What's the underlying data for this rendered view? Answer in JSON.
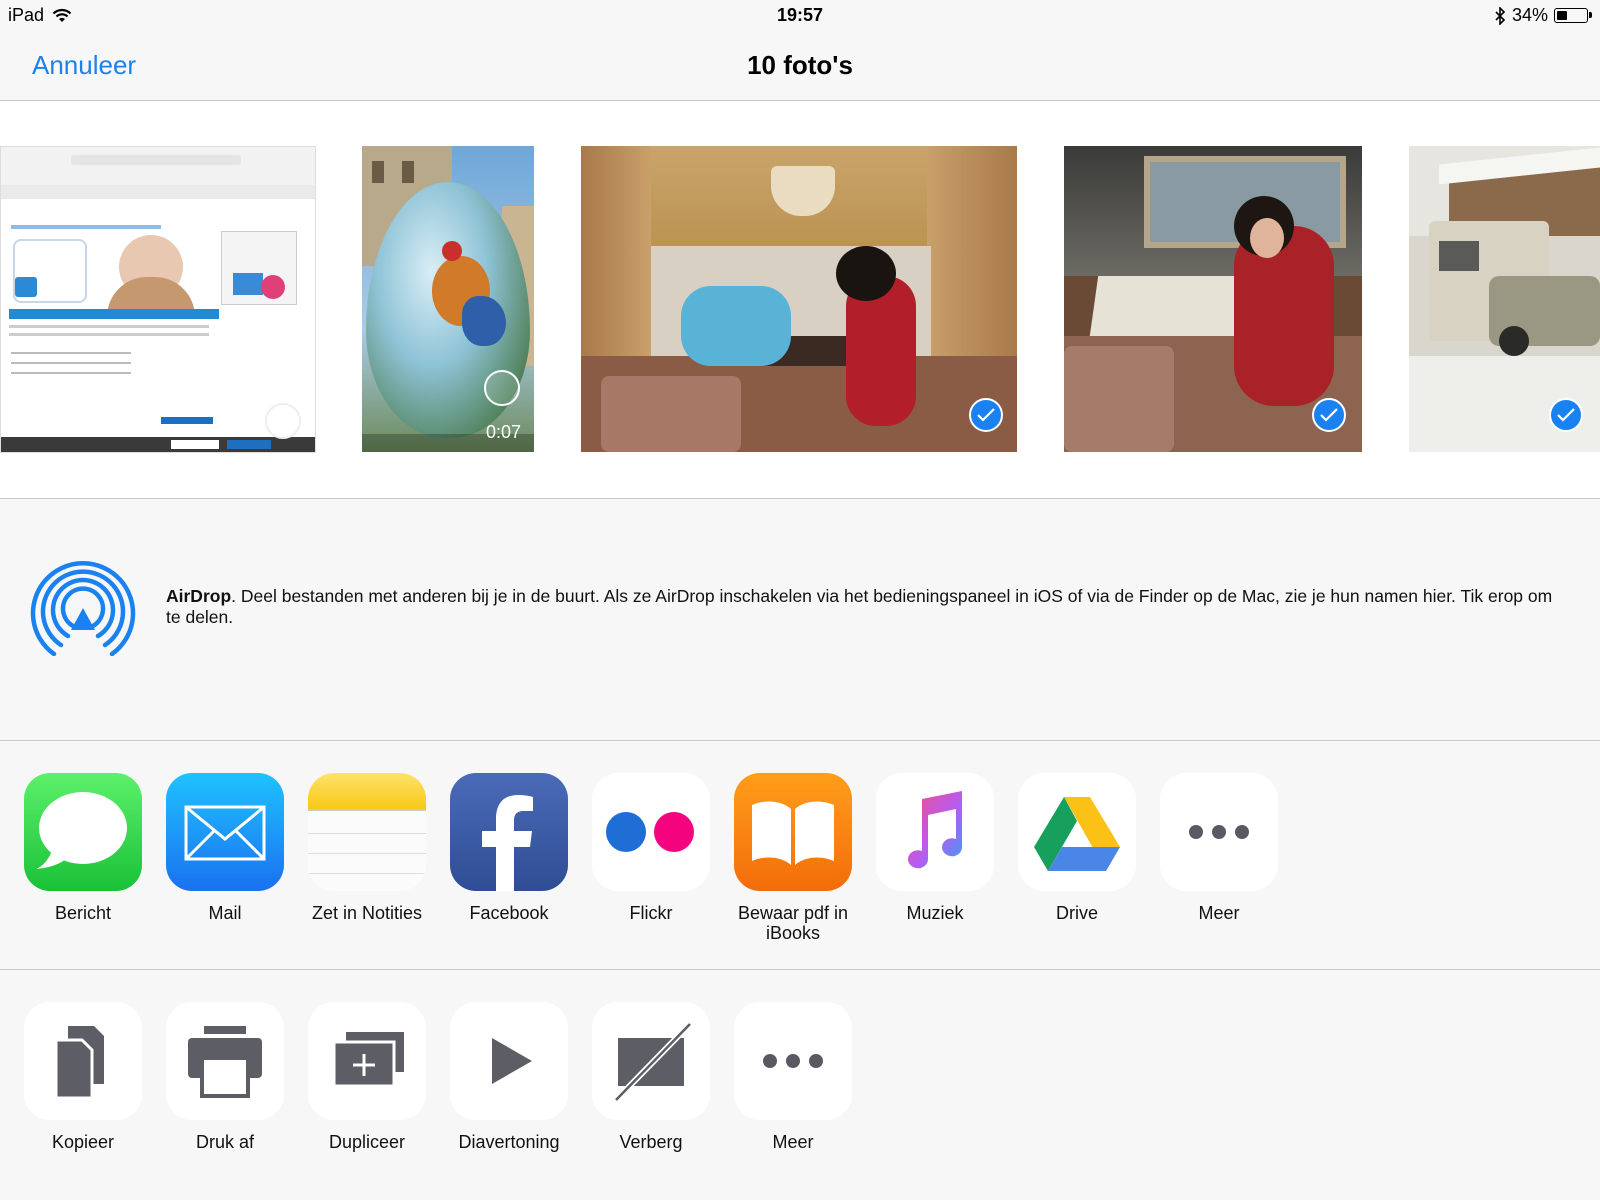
{
  "status_bar": {
    "device": "iPad",
    "time": "19:57",
    "battery_percent": "34%"
  },
  "nav": {
    "cancel_label": "Annuleer",
    "title": "10 foto's"
  },
  "photos": [
    {
      "kind": "screenshot",
      "selected": false
    },
    {
      "kind": "video",
      "duration": "0:07",
      "selected": false
    },
    {
      "kind": "photo",
      "selected": true
    },
    {
      "kind": "photo",
      "selected": true
    },
    {
      "kind": "photo",
      "selected": true
    }
  ],
  "airdrop": {
    "title": "AirDrop",
    "description": ". Deel bestanden met anderen bij je in de buurt. Als ze AirDrop inschakelen via het bedieningspaneel in iOS of via de Finder op de Mac, zie je hun namen hier. Tik erop om te delen."
  },
  "share_apps": [
    {
      "label": "Bericht",
      "icon": "messages-icon"
    },
    {
      "label": "Mail",
      "icon": "mail-icon"
    },
    {
      "label": "Zet in Notities",
      "icon": "notes-icon"
    },
    {
      "label": "Facebook",
      "icon": "facebook-icon"
    },
    {
      "label": "Flickr",
      "icon": "flickr-icon"
    },
    {
      "label": "Bewaar pdf in iBooks",
      "icon": "ibooks-icon"
    },
    {
      "label": "Muziek",
      "icon": "music-icon"
    },
    {
      "label": "Drive",
      "icon": "drive-icon"
    },
    {
      "label": "Meer",
      "icon": "more-icon"
    }
  ],
  "actions": [
    {
      "label": "Kopieer",
      "icon": "copy-icon"
    },
    {
      "label": "Druk af",
      "icon": "print-icon"
    },
    {
      "label": "Dupliceer",
      "icon": "duplicate-icon"
    },
    {
      "label": "Diavertoning",
      "icon": "slideshow-icon"
    },
    {
      "label": "Verberg",
      "icon": "hide-icon"
    },
    {
      "label": "Meer",
      "icon": "more-icon"
    }
  ],
  "colors": {
    "accent": "#1a82f0",
    "background": "#f7f7f7",
    "separator": "#c8c8cc"
  }
}
